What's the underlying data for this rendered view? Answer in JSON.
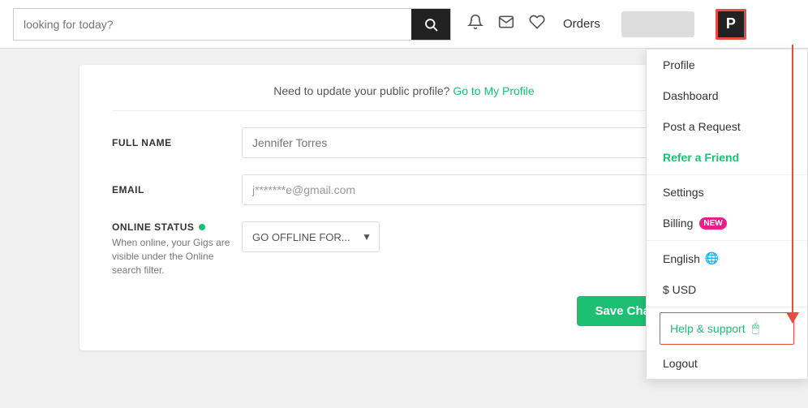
{
  "header": {
    "search_placeholder": "looking for today?",
    "orders_label": "Orders",
    "avatar_letter": "P",
    "search_btn_label": "Search"
  },
  "notice": {
    "text": "Need to update your public profile?",
    "link_text": "Go to My Profile"
  },
  "form": {
    "full_name_label": "FULL NAME",
    "full_name_placeholder": "Jennifer Torres",
    "email_label": "EMAIL",
    "email_value": "j*******e@gmail.com",
    "online_status_label": "ONLINE STATUS",
    "online_desc": "When online, your Gigs are visible under the Online search filter.",
    "offline_select_value": "GO OFFLINE FOR...",
    "save_label": "Save Changes"
  },
  "dropdown": {
    "items": [
      {
        "label": "Profile",
        "type": "normal"
      },
      {
        "label": "Dashboard",
        "type": "normal"
      },
      {
        "label": "Post a Request",
        "type": "normal"
      },
      {
        "label": "Refer a Friend",
        "type": "green"
      },
      {
        "label": "Settings",
        "type": "normal"
      },
      {
        "label": "Billing",
        "type": "normal",
        "badge": "NEW"
      },
      {
        "label": "English",
        "type": "lang"
      },
      {
        "label": "$ USD",
        "type": "normal"
      },
      {
        "label": "Help & support",
        "type": "help"
      },
      {
        "label": "Logout",
        "type": "normal"
      }
    ]
  },
  "colors": {
    "green": "#1dbf73",
    "red": "#e74c3c",
    "pink_badge": "#e91e8c"
  }
}
